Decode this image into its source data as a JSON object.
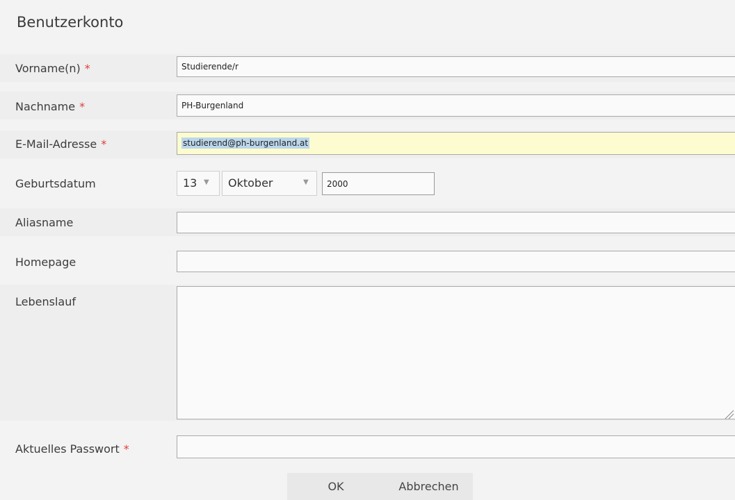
{
  "page": {
    "title": "Benutzerkonto"
  },
  "form": {
    "first_name": {
      "label": "Vorname(n)",
      "required": "*",
      "value": "Studierende/r"
    },
    "last_name": {
      "label": "Nachname",
      "required": "*",
      "value": "PH-Burgenland"
    },
    "email": {
      "label": "E-Mail-Adresse",
      "required": "*",
      "value": "studierend@ph-burgenland.at"
    },
    "birthdate": {
      "label": "Geburtsdatum",
      "day": "13",
      "month": "Oktober",
      "year": "2000"
    },
    "alias": {
      "label": "Aliasname",
      "value": ""
    },
    "homepage": {
      "label": "Homepage",
      "value": ""
    },
    "cv": {
      "label": "Lebenslauf",
      "value": ""
    },
    "current_password": {
      "label": "Aktuelles Passwort",
      "required": "*",
      "value": ""
    }
  },
  "buttons": {
    "ok": "OK",
    "cancel": "Abbrechen"
  },
  "icons": {
    "dropdown": "chevron-down-icon",
    "resize": "resize-grip-icon"
  },
  "colors": {
    "required": "#e03c3c",
    "highlight": "#fdfcd0",
    "selection": "#bcd7ec"
  }
}
